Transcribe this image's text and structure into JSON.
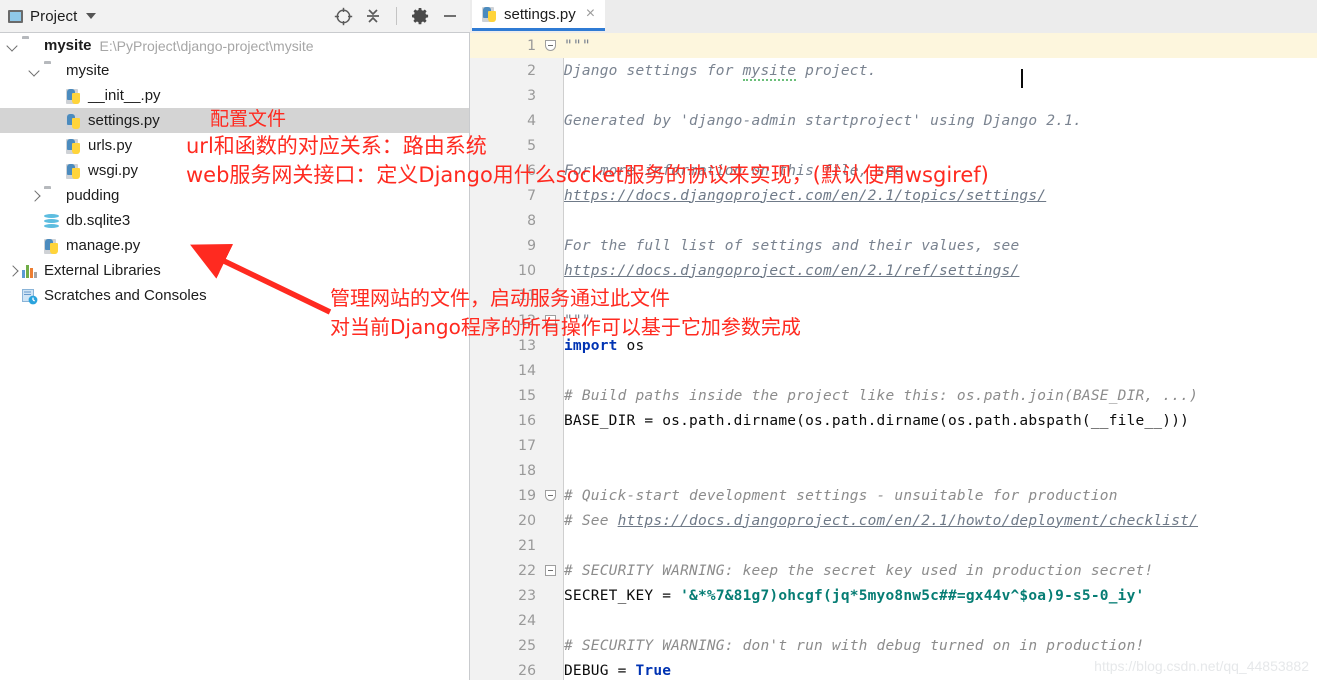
{
  "window": {
    "project_panel": {
      "title": "Project",
      "icons": [
        {
          "name": "locate-target-icon"
        },
        {
          "name": "collapse-all-icon"
        },
        {
          "name": "settings-gear-icon"
        },
        {
          "name": "minimize-icon"
        }
      ],
      "tree": [
        {
          "label": "mysite",
          "sub": "E:\\PyProject\\django-project\\mysite",
          "icon": "folder-icon",
          "depth": 0,
          "twisty": "open",
          "bold": true,
          "selected": false
        },
        {
          "label": "mysite",
          "sub": "",
          "icon": "module-folder-icon",
          "depth": 1,
          "twisty": "open",
          "bold": false,
          "selected": false
        },
        {
          "label": "__init__.py",
          "sub": "",
          "icon": "python-file-icon",
          "depth": 2,
          "twisty": "none",
          "bold": false,
          "selected": false
        },
        {
          "label": "settings.py",
          "sub": "",
          "icon": "python-file-icon",
          "depth": 2,
          "twisty": "none",
          "bold": false,
          "selected": true
        },
        {
          "label": "urls.py",
          "sub": "",
          "icon": "python-file-icon",
          "depth": 2,
          "twisty": "none",
          "bold": false,
          "selected": false
        },
        {
          "label": "wsgi.py",
          "sub": "",
          "icon": "python-file-icon",
          "depth": 2,
          "twisty": "none",
          "bold": false,
          "selected": false
        },
        {
          "label": "pudding",
          "sub": "",
          "icon": "module-folder-icon",
          "depth": 1,
          "twisty": "closed",
          "bold": false,
          "selected": false
        },
        {
          "label": "db.sqlite3",
          "sub": "",
          "icon": "database-icon",
          "depth": 1,
          "twisty": "none",
          "bold": false,
          "selected": false
        },
        {
          "label": "manage.py",
          "sub": "",
          "icon": "python-file-icon",
          "depth": 1,
          "twisty": "none",
          "bold": false,
          "selected": false
        },
        {
          "label": "External Libraries",
          "sub": "",
          "icon": "libraries-icon",
          "depth": 0,
          "twisty": "closed",
          "bold": false,
          "selected": false
        },
        {
          "label": "Scratches and Consoles",
          "sub": "",
          "icon": "scratches-icon",
          "depth": 0,
          "twisty": "none",
          "bold": false,
          "selected": false
        }
      ]
    },
    "editor": {
      "tab": {
        "label": "settings.py",
        "icon": "python-file-icon",
        "close": "×"
      },
      "caret_line": 1,
      "lines": [
        {
          "n": "1",
          "fold": "top",
          "indent": 0,
          "segments": [
            {
              "t": "\"\"\"",
              "c": "doc"
            }
          ]
        },
        {
          "n": "2",
          "fold": "",
          "indent": 0,
          "segments": [
            {
              "t": "Django settings for ",
              "c": "doc"
            },
            {
              "t": "mysite",
              "c": "doc wavy"
            },
            {
              "t": " project.",
              "c": "doc"
            }
          ]
        },
        {
          "n": "3",
          "fold": "",
          "indent": 0,
          "segments": []
        },
        {
          "n": "4",
          "fold": "",
          "indent": 0,
          "segments": [
            {
              "t": "Generated by 'django-admin startproject' using Django 2.1.",
              "c": "doc"
            }
          ]
        },
        {
          "n": "5",
          "fold": "",
          "indent": 0,
          "segments": []
        },
        {
          "n": "6",
          "fold": "",
          "indent": 0,
          "segments": [
            {
              "t": "For more information on this file, see",
              "c": "doc"
            }
          ]
        },
        {
          "n": "7",
          "fold": "",
          "indent": 0,
          "segments": [
            {
              "t": "https://docs.djangoproject.com/en/2.1/topics/settings/",
              "c": "link"
            }
          ]
        },
        {
          "n": "8",
          "fold": "",
          "indent": 0,
          "segments": []
        },
        {
          "n": "9",
          "fold": "",
          "indent": 0,
          "segments": [
            {
              "t": "For the full list of settings and their values, see",
              "c": "doc"
            }
          ]
        },
        {
          "n": "10",
          "fold": "",
          "indent": 0,
          "segments": [
            {
              "t": "https://docs.djangoproject.com/en/2.1/ref/settings/",
              "c": "link"
            }
          ]
        },
        {
          "n": "11",
          "fold": "",
          "indent": 0,
          "segments": []
        },
        {
          "n": "12",
          "fold": "bot",
          "indent": 0,
          "segments": [
            {
              "t": "\"\"\"",
              "c": "doc"
            }
          ]
        },
        {
          "n": "13",
          "fold": "",
          "indent": 0,
          "segments": [
            {
              "t": "import",
              "c": "kw"
            },
            {
              "t": " os",
              "c": "plain"
            }
          ]
        },
        {
          "n": "14",
          "fold": "",
          "indent": 0,
          "segments": []
        },
        {
          "n": "15",
          "fold": "",
          "indent": 0,
          "segments": [
            {
              "t": "# Build paths inside the project like this: os.path.join(BASE_DIR, ...)",
              "c": "cmt"
            }
          ]
        },
        {
          "n": "16",
          "fold": "",
          "indent": 0,
          "segments": [
            {
              "t": "BASE_DIR = os.path.dirname(os.path.dirname(os.path.abspath(__file__)))",
              "c": "plain"
            }
          ]
        },
        {
          "n": "17",
          "fold": "",
          "indent": 0,
          "segments": []
        },
        {
          "n": "18",
          "fold": "",
          "indent": 0,
          "segments": []
        },
        {
          "n": "19",
          "fold": "top",
          "indent": 0,
          "segments": [
            {
              "t": "# Quick-start development settings - unsuitable for production",
              "c": "cmt"
            }
          ]
        },
        {
          "n": "20",
          "fold": "",
          "indent": 0,
          "segments": [
            {
              "t": "# See ",
              "c": "cmt"
            },
            {
              "t": "https://docs.djangoproject.com/en/2.1/howto/deployment/checklist/",
              "c": "link"
            }
          ]
        },
        {
          "n": "21",
          "fold": "",
          "indent": 0,
          "segments": []
        },
        {
          "n": "22",
          "fold": "sq",
          "indent": 0,
          "segments": [
            {
              "t": "# SECURITY WARNING: keep the secret key used in production secret!",
              "c": "cmt"
            }
          ]
        },
        {
          "n": "23",
          "fold": "",
          "indent": 0,
          "segments": [
            {
              "t": "SECRET_KEY = ",
              "c": "plain"
            },
            {
              "t": "'&*%7&81g7)ohcgf(jq*5myo8nw5c##=gx44v^$oa)9-s5-0_iy'",
              "c": "str"
            }
          ]
        },
        {
          "n": "24",
          "fold": "",
          "indent": 0,
          "segments": []
        },
        {
          "n": "25",
          "fold": "",
          "indent": 0,
          "segments": [
            {
              "t": "# SECURITY WARNING: don't run with debug turned on in production!",
              "c": "cmt"
            }
          ]
        },
        {
          "n": "26",
          "fold": "",
          "indent": 0,
          "segments": [
            {
              "t": "DEBUG = ",
              "c": "plain"
            },
            {
              "t": "True",
              "c": "kw"
            }
          ]
        }
      ]
    },
    "annotations": [
      {
        "id": "anno-settings",
        "text": "配置文件"
      },
      {
        "id": "anno-urls",
        "text": "url和函数的对应关系：路由系统"
      },
      {
        "id": "anno-wsgi",
        "text": "web服务网关接口：定义Django用什么socket服务的协议来实现，(默认使用wsgiref)"
      },
      {
        "id": "anno-manage-1",
        "text": "管理网站的文件，启动服务通过此文件"
      },
      {
        "id": "anno-manage-2",
        "text": "对当前Django程序的所有操作可以基于它加参数完成"
      }
    ],
    "watermark": "https://blog.csdn.net/qq_44853882",
    "colors": {
      "annotation_red": "#ff2a20",
      "tab_accent": "#2f7bd4",
      "selection_gray": "#d4d4d4",
      "current_line": "#fdf6dd",
      "string_teal": "#067d74",
      "keyword_blue": "#0033b3"
    }
  }
}
